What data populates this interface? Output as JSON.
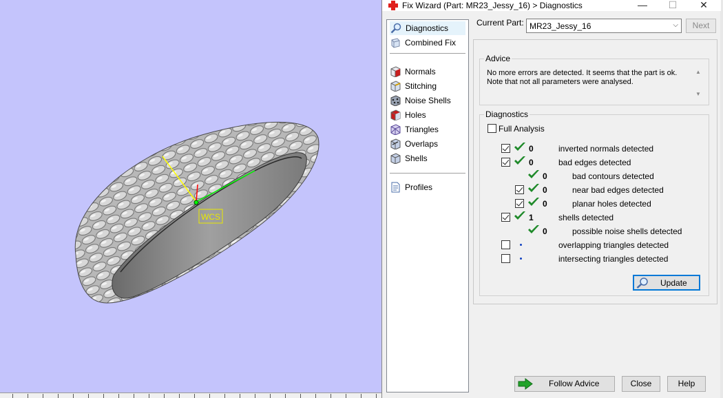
{
  "viewport": {
    "background": "#c4c4fc",
    "axis_label": "WCS"
  },
  "dialog": {
    "title": "Fix Wizard (Part: MR23_Jessy_16) > Diagnostics",
    "title_icon": "red-cross-icon",
    "window_controls": {
      "minimize": "—",
      "maximize": "☐",
      "close": "✕"
    },
    "nav": {
      "items": [
        {
          "label": "Diagnostics",
          "icon": "magnifier-icon",
          "selected": true
        },
        {
          "label": "Combined Fix",
          "icon": "combined-fix-icon"
        },
        {
          "label": "Normals",
          "icon": "normals-icon"
        },
        {
          "label": "Stitching",
          "icon": "stitching-icon"
        },
        {
          "label": "Noise Shells",
          "icon": "noise-shells-icon"
        },
        {
          "label": "Holes",
          "icon": "holes-icon"
        },
        {
          "label": "Triangles",
          "icon": "triangles-icon"
        },
        {
          "label": "Overlaps",
          "icon": "overlaps-icon"
        },
        {
          "label": "Shells",
          "icon": "shells-icon"
        },
        {
          "label": "Profiles",
          "icon": "profiles-icon"
        }
      ]
    },
    "current_part_label": "Current Part:",
    "current_part_value": "MR23_Jessy_16",
    "next_label": "Next",
    "advice": {
      "title": "Advice",
      "line1": "No more errors are detected. It seems that the part is ok.",
      "line2": "Note that not all parameters were analysed."
    },
    "diagnostics": {
      "title": "Diagnostics",
      "full_analysis_label": "Full Analysis",
      "full_analysis_checked": false,
      "rows": [
        {
          "checkbox": true,
          "status": "ok",
          "count": "0",
          "label": "inverted normals detected",
          "indent": 0
        },
        {
          "checkbox": true,
          "status": "ok",
          "count": "0",
          "label": "bad edges detected",
          "indent": 0
        },
        {
          "checkbox": null,
          "status": "ok",
          "count": "0",
          "label": "bad contours detected",
          "indent": 1
        },
        {
          "checkbox": true,
          "status": "ok",
          "count": "0",
          "label": "near bad edges detected",
          "indent": 1
        },
        {
          "checkbox": true,
          "status": "ok",
          "count": "0",
          "label": "planar holes detected",
          "indent": 1
        },
        {
          "checkbox": true,
          "status": "ok",
          "count": "1",
          "label": "shells detected",
          "indent": 0
        },
        {
          "checkbox": null,
          "status": "ok",
          "count": "0",
          "label": "possible noise shells detected",
          "indent": 1
        },
        {
          "checkbox": false,
          "status": "dot",
          "count": "",
          "label": "overlapping triangles detected",
          "indent": 0
        },
        {
          "checkbox": false,
          "status": "dot",
          "count": "",
          "label": "intersecting triangles detected",
          "indent": 0
        }
      ],
      "update_label": "Update"
    },
    "footer": {
      "follow_advice_label": "Follow Advice",
      "close_label": "Close",
      "help_label": "Help"
    }
  }
}
